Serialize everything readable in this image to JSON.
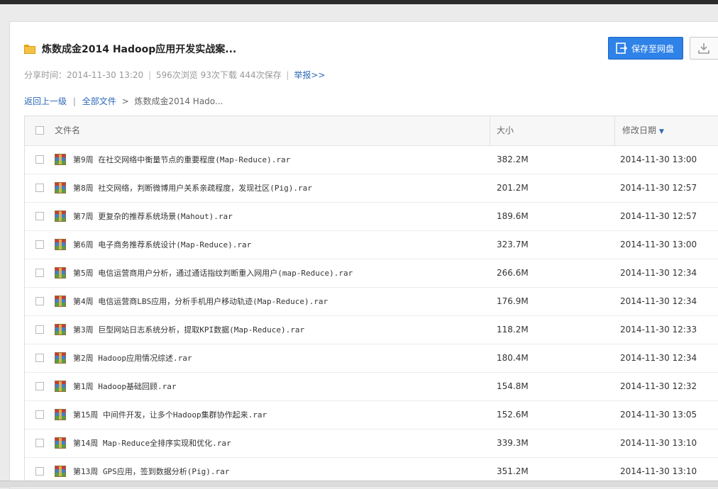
{
  "share": {
    "title": "炼数成金2014 Hadoop应用开发实战案...",
    "save_button": "保存至网盘",
    "download_icon": "download-icon",
    "meta": {
      "share_time_label": "分享时间：",
      "share_time": "2014-11-30 13:20",
      "views": "596次浏览",
      "downloads": "93次下载",
      "saves": "444次保存",
      "report": "举报>>"
    }
  },
  "breadcrumb": {
    "back": "返回上一级",
    "all_files": "全部文件",
    "separator": ">",
    "current": "炼数成金2014 Hado..."
  },
  "table": {
    "headers": {
      "name": "文件名",
      "size": "大小",
      "modified": "修改日期"
    },
    "sort_indicator": "▼",
    "rows": [
      {
        "name": "第9周 在社交网络中衡量节点的重要程度(Map-Reduce).rar",
        "size": "382.2M",
        "date": "2014-11-30 13:00"
      },
      {
        "name": "第8周 社交网络，判断微博用户关系亲疏程度，发现社区(Pig).rar",
        "size": "201.2M",
        "date": "2014-11-30 12:57"
      },
      {
        "name": "第7周 更复杂的推荐系统场景(Mahout).rar",
        "size": "189.6M",
        "date": "2014-11-30 12:57"
      },
      {
        "name": "第6周 电子商务推荐系统设计(Map-Reduce).rar",
        "size": "323.7M",
        "date": "2014-11-30 13:00"
      },
      {
        "name": "第5周 电信运营商用户分析，通过通话指纹判断重入网用户(map-Reduce).rar",
        "size": "266.6M",
        "date": "2014-11-30 12:34"
      },
      {
        "name": "第4周 电信运营商LBS应用，分析手机用户移动轨迹(Map-Reduce).rar",
        "size": "176.9M",
        "date": "2014-11-30 12:34"
      },
      {
        "name": "第3周 巨型网站日志系统分析，提取KPI数据(Map-Reduce).rar",
        "size": "118.2M",
        "date": "2014-11-30 12:33"
      },
      {
        "name": "第2周 Hadoop应用情况综述.rar",
        "size": "180.4M",
        "date": "2014-11-30 12:34"
      },
      {
        "name": "第1周 Hadoop基础回顾.rar",
        "size": "154.8M",
        "date": "2014-11-30 12:32"
      },
      {
        "name": "第15周 中间件开发，让多个Hadoop集群协作起来.rar",
        "size": "152.6M",
        "date": "2014-11-30 13:05"
      },
      {
        "name": "第14周 Map-Reduce全排序实现和优化.rar",
        "size": "339.3M",
        "date": "2014-11-30 13:10"
      },
      {
        "name": "第13周 GPS应用，签到数据分析(Pig).rar",
        "size": "351.2M",
        "date": "2014-11-30 13:10"
      }
    ]
  },
  "colors": {
    "accent": "#2e82e8",
    "link": "#2d6ab8"
  }
}
